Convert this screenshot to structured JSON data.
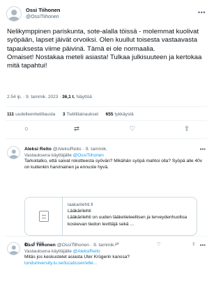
{
  "tweet": {
    "author_name": "Ossi Tiihonen",
    "author_handle": "@OssiTiihonen",
    "text_p1": "Nelikymppinen pariskunta, sote-alalla töissä - molemmat kuolivat syöpään, lapset jäivät orvoiksi. Olen kuullut toisesta vastaavasta tapauksesta viime päivinä. Tämä ei ole normaalia.",
    "text_p2": "Omaiset! Nostakaa meteli asiasta! Tulkaa julkisuuteen ja kertokaa mitä tapahtui!",
    "time": "2.54 ip.",
    "date": "9. tammik. 2023",
    "views_value": "36,1 t.",
    "views_label": "Näyttöä",
    "meta_sep": "·"
  },
  "stats": {
    "retweets_value": "111",
    "retweets_label": "uudelleentwiittausta",
    "quotes_value": "3",
    "quotes_label": "Twiittilainaukset",
    "likes_value": "655",
    "likes_label": "tykkäystä"
  },
  "actions": {
    "reply_icon": "○",
    "retweet_icon": "⇄",
    "like_icon": "♡",
    "share_icon": "⇧"
  },
  "replies": [
    {
      "name": "Aleksi Reito",
      "handle": "@AleksiReito",
      "date": "9. tammik.",
      "replying_prefix": "Vastauksena käyttäjälle",
      "replying_to": "@OssiTiihonen",
      "text": "Tarkoitatko, että saivat rokotteesta syövän? Mikähän syöpä mahtoi olla? Syöpä alle 40v on kuitenkin harvinainen ja ennuste hyvä.",
      "card": {
        "domain": "laakarilehti.fi",
        "title": "Lääkärilehti",
        "description": "Lääkärilehti on uuden lääketieteellisen ja terveydenhuoltoa koskevan tiedon levittäjä sekä ..."
      },
      "views": "4 228"
    },
    {
      "name": "Ossi Tiihonen",
      "handle": "@OssiTiihonen",
      "date": "9. tammik.",
      "replying_prefix": "Vastauksena käyttäjälle",
      "replying_to": "@AleksiReito",
      "text": "Mitäs jos keskustelet asiasta Uter Krügerin kanssa?",
      "link": "lunduniversity.lu.se/lucat/user/e6e..."
    }
  ]
}
